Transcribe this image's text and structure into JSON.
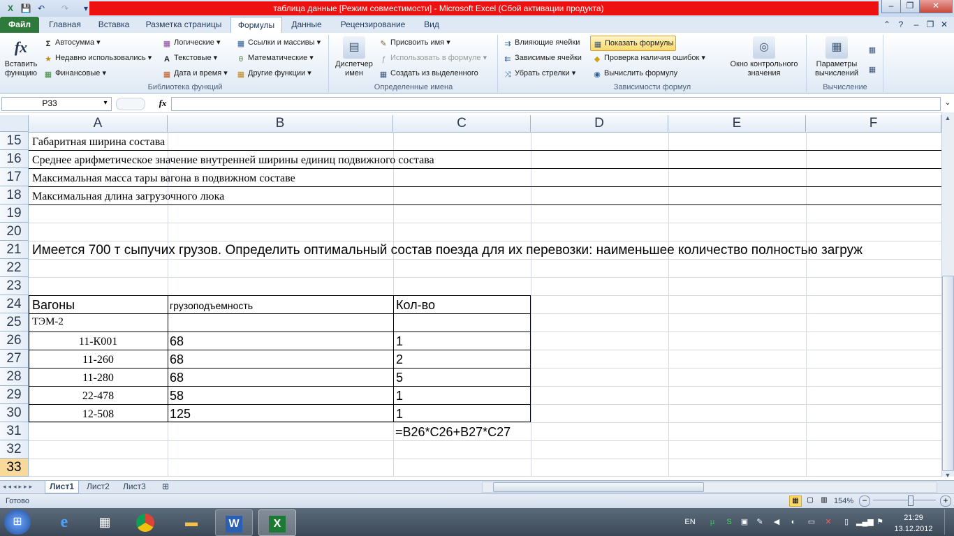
{
  "window": {
    "title": "таблица данные  [Режим совместимости]  -  Microsoft Excel (Сбой активации продукта)",
    "controls": [
      "–",
      "❐",
      "✕"
    ],
    "doc_controls": [
      "–",
      "❐",
      "✕"
    ]
  },
  "tabs": {
    "file": "Файл",
    "items": [
      "Главная",
      "Вставка",
      "Разметка страницы",
      "Формулы",
      "Данные",
      "Рецензирование",
      "Вид"
    ]
  },
  "ribbon": {
    "insert_function": {
      "line1": "Вставить",
      "line2": "функцию"
    },
    "function_library": {
      "label": "Библиотека функций",
      "autosum": "Автосумма",
      "recent": "Недавно использовались",
      "financial": "Финансовые",
      "logical": "Логические",
      "text": "Текстовые",
      "datetime": "Дата и время",
      "lookup": "Ссылки и массивы",
      "math": "Математические",
      "more": "Другие функции"
    },
    "defined_names": {
      "label": "Определенные имена",
      "manager_line1": "Диспетчер",
      "manager_line2": "имен",
      "assign_name": "Присвоить имя",
      "use_in_formula": "Использовать в формуле",
      "create_from_selection": "Создать из выделенного"
    },
    "formula_auditing": {
      "label": "Зависимости формул",
      "trace_precedents": "Влияющие ячейки",
      "trace_dependents": "Зависимые ячейки",
      "remove_arrows": "Убрать стрелки",
      "show_formulas": "Показать формулы",
      "error_checking": "Проверка наличия ошибок",
      "evaluate_formula": "Вычислить формулу",
      "watch_line1": "Окно контрольного",
      "watch_line2": "значения"
    },
    "calculation": {
      "label": "Вычисление",
      "options_line1": "Параметры",
      "options_line2": "вычислений"
    }
  },
  "formula_bar": {
    "name_box": "P33",
    "fx": "fx",
    "content": ""
  },
  "grid": {
    "columns": [
      "A",
      "B",
      "C",
      "D",
      "E",
      "F"
    ],
    "rows": [
      {
        "num": "15",
        "a": "Габаритная ширина состава"
      },
      {
        "num": "16",
        "a": "Среднее арифметическое значение внутренней ширины единиц подвижного состава"
      },
      {
        "num": "17",
        "a": "Максимальная масса тары вагона в подвижном составе"
      },
      {
        "num": "18",
        "a": "Максимальная длина загрузочного люка"
      },
      {
        "num": "19"
      },
      {
        "num": "20"
      },
      {
        "num": "21",
        "a": "Имеется 700 т сыпучих грузов. Определить оптимальный состав поезда для их перевозки: наименьшее количество полностью загруж"
      },
      {
        "num": "22"
      },
      {
        "num": "23"
      },
      {
        "num": "24",
        "a": "Вагоны",
        "b": "грузоподъемность",
        "c": "Кол-во"
      },
      {
        "num": "25",
        "a": "ТЭМ-2"
      },
      {
        "num": "26",
        "a": "11-К001",
        "b": "68",
        "c": "1"
      },
      {
        "num": "27",
        "a": "11-260",
        "b": "68",
        "c": "2"
      },
      {
        "num": "28",
        "a": "11-280",
        "b": "68",
        "c": "5"
      },
      {
        "num": "29",
        "a": "22-478",
        "b": "58",
        "c": "1"
      },
      {
        "num": "30",
        "a": "12-508",
        "b": "125",
        "c": "1"
      },
      {
        "num": "31",
        "c": "=B26*C26+B27*C27"
      },
      {
        "num": "32"
      },
      {
        "num": "33"
      }
    ]
  },
  "sheets": [
    "Лист1",
    "Лист2",
    "Лист3"
  ],
  "status": {
    "ready": "Готово",
    "zoom": "154%",
    "zoom_out": "−",
    "zoom_in": "+"
  },
  "taskbar": {
    "lang": "EN",
    "time": "21:29",
    "date": "13.12.2012"
  },
  "colors": {
    "title_bar_error": "#ee1111",
    "file_tab": "#2d7a3b",
    "selected_row": "#f9d99a"
  }
}
